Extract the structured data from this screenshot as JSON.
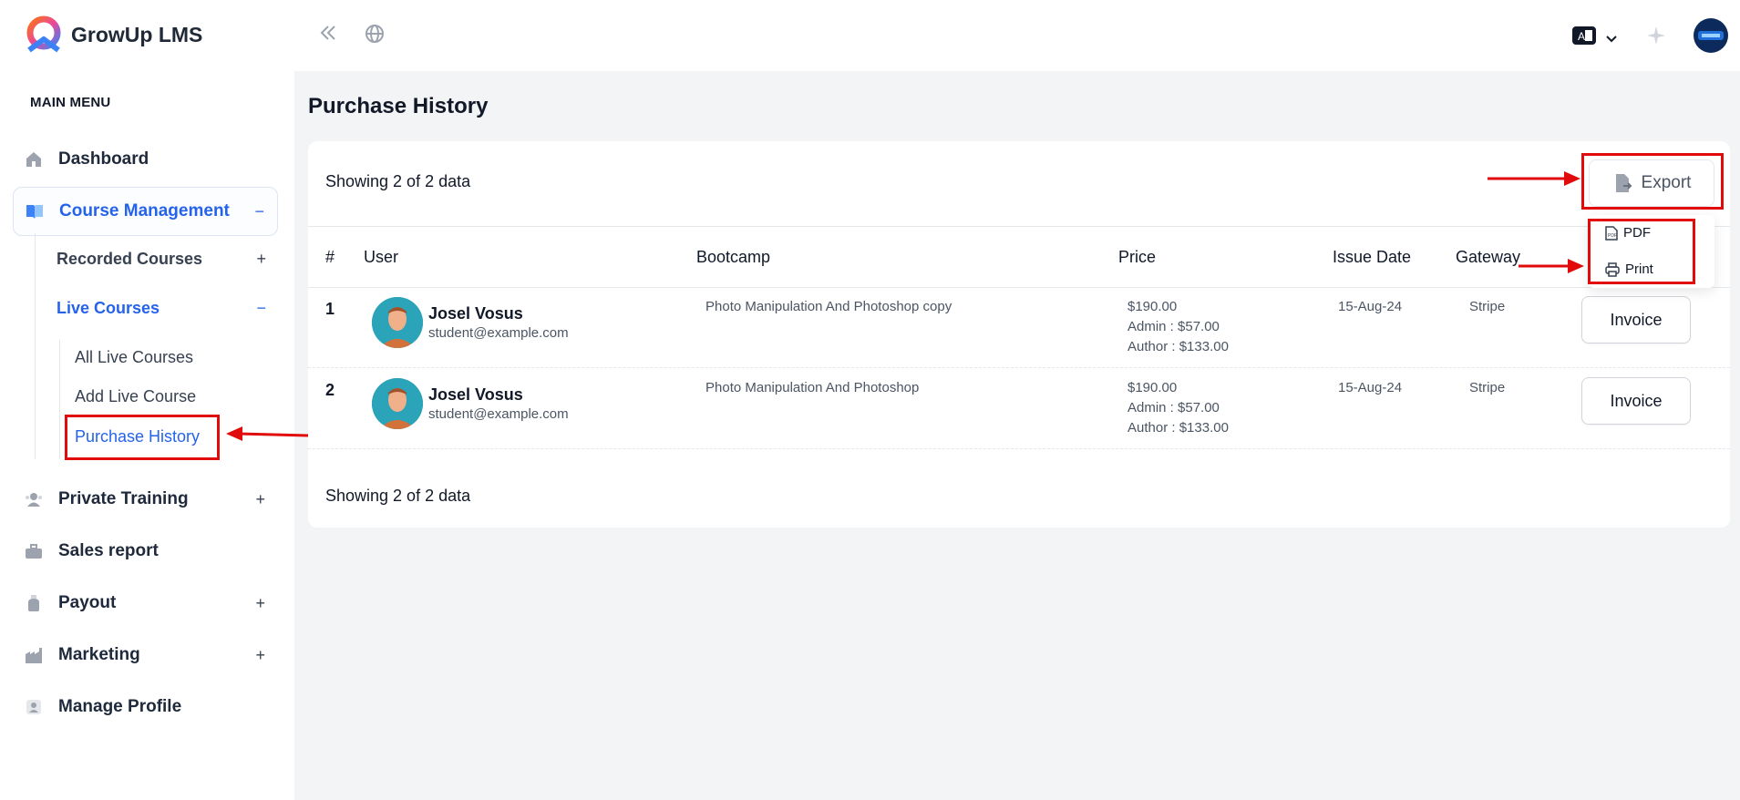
{
  "app": {
    "name": "GrowUp LMS"
  },
  "sidebar": {
    "menu_title": "MAIN MENU",
    "items": [
      {
        "label": "Dashboard",
        "icon": "home-icon"
      },
      {
        "label": "Course Management",
        "icon": "book-icon",
        "toggle": "−"
      },
      {
        "label": "Private Training",
        "icon": "users-icon",
        "toggle": "+"
      },
      {
        "label": "Sales report",
        "icon": "briefcase-icon"
      },
      {
        "label": "Payout",
        "icon": "money-bag-icon",
        "toggle": "+"
      },
      {
        "label": "Marketing",
        "icon": "factory-icon",
        "toggle": "+"
      },
      {
        "label": "Manage Profile",
        "icon": "profile-card-icon"
      }
    ],
    "sub": {
      "recorded": {
        "label": "Recorded Courses",
        "toggle": "+"
      },
      "live": {
        "label": "Live Courses",
        "toggle": "−"
      },
      "live_children": [
        "All Live Courses",
        "Add Live Course",
        "Purchase History"
      ]
    }
  },
  "page": {
    "title": "Purchase History",
    "showing_top": "Showing 2 of 2 data",
    "showing_bottom": "Showing 2 of 2 data",
    "export_label": "Export",
    "export_menu": {
      "pdf": "PDF",
      "print": "Print"
    }
  },
  "table": {
    "headers": [
      "#",
      "User",
      "Bootcamp",
      "Price",
      "Issue Date",
      "Gateway"
    ],
    "rows": [
      {
        "index": "1",
        "name": "Josel Vosus",
        "email": "student@example.com",
        "bootcamp": "Photo Manipulation And Photoshop copy",
        "price": "$190.00",
        "admin": "Admin : $57.00",
        "author": "Author : $133.00",
        "date": "15-Aug-24",
        "gateway": "Stripe",
        "action": "Invoice"
      },
      {
        "index": "2",
        "name": "Josel Vosus",
        "email": "student@example.com",
        "bootcamp": "Photo Manipulation And Photoshop",
        "price": "$190.00",
        "admin": "Admin : $57.00",
        "author": "Author : $133.00",
        "date": "15-Aug-24",
        "gateway": "Stripe",
        "action": "Invoice"
      }
    ]
  },
  "colors": {
    "accent": "#2563eb",
    "annotation": "#e10b0b"
  }
}
